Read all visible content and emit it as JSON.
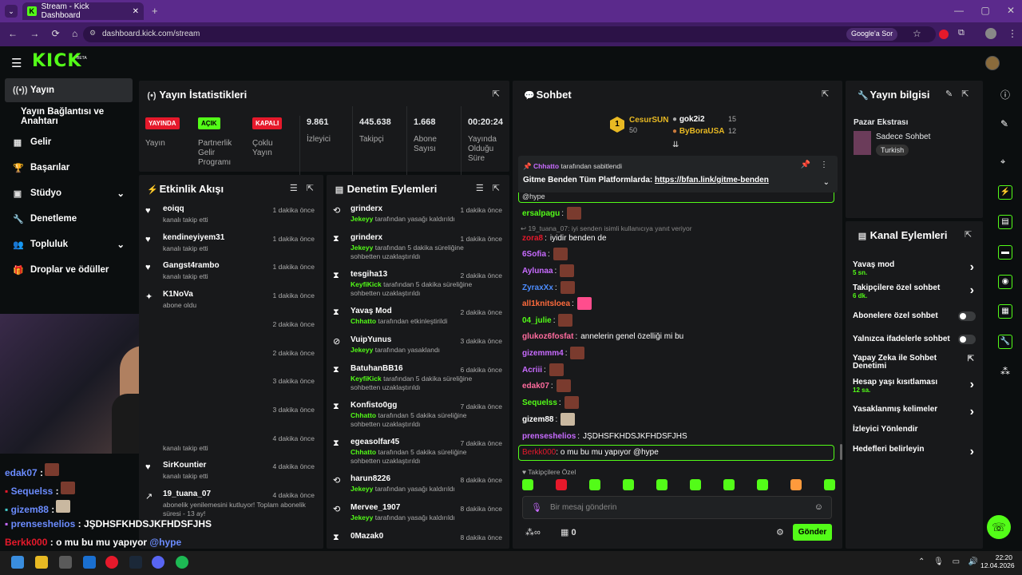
{
  "browser": {
    "tab_title": "Stream - Kick Dashboard",
    "url": "dashboard.kick.com/stream",
    "google_btn": "Google'a Sor"
  },
  "logo": "KICK",
  "logo_beta": "BETA",
  "sidebar": [
    {
      "label": "Yayın",
      "icon": "broadcast-icon"
    },
    {
      "label": "Yayın Bağlantısı ve Anahtarı"
    },
    {
      "label": "Gelir",
      "icon": "chart-icon"
    },
    {
      "label": "Başarılar",
      "icon": "trophy-icon"
    },
    {
      "label": "Stüdyo",
      "icon": "studio-icon"
    },
    {
      "label": "Denetleme",
      "icon": "wrench-icon"
    },
    {
      "label": "Topluluk",
      "icon": "people-icon"
    },
    {
      "label": "Droplar ve ödüller",
      "icon": "gift-icon"
    }
  ],
  "stats": {
    "title": "Yayın İstatistikleri",
    "items": [
      {
        "badge": "YAYINDA",
        "badge_color": "#e6192b",
        "label": "Yayın"
      },
      {
        "badge": "AÇIK",
        "badge_color": "#53fc18",
        "label": "Partnerlik Gelir Programı"
      },
      {
        "badge": "KAPALI",
        "badge_color": "#e6192b",
        "label": "Çoklu Yayın"
      },
      {
        "value": "9.861",
        "label": "İzleyici"
      },
      {
        "value": "445.638",
        "label": "Takipçi"
      },
      {
        "value": "1.668",
        "label": "Abone Sayısı"
      },
      {
        "value": "00:20:24",
        "label": "Yayında Olduğu Süre"
      }
    ]
  },
  "activity": {
    "title": "Etkinlik Akışı",
    "rows": [
      {
        "name": "eoiqq",
        "sub": "kanalı takip etti",
        "time": "1 dakika önce"
      },
      {
        "name": "kendineyiyem31",
        "sub": "kanalı takip etti",
        "time": "1 dakika önce"
      },
      {
        "name": "Gangst4rambo",
        "sub": "kanalı takip etti",
        "time": "1 dakika önce"
      },
      {
        "name": "K1NoVa",
        "sub": "abone oldu",
        "time": "1 dakika önce"
      },
      {
        "name": "",
        "sub": "",
        "time": "2 dakika önce"
      },
      {
        "name": "",
        "sub": "",
        "time": "2 dakika önce"
      },
      {
        "name": "",
        "sub": "",
        "time": "3 dakika önce"
      },
      {
        "name": "",
        "sub": "",
        "time": "3 dakika önce"
      },
      {
        "name": "",
        "sub": "kanalı takip etti",
        "time": "4 dakika önce"
      },
      {
        "name": "SirKountier",
        "sub": "kanalı takip etti",
        "time": "4 dakika önce"
      },
      {
        "name": "19_tuana_07",
        "sub": "abonelik yenilemesini kutluyor! Toplam abonelik süresi - 13 ay!",
        "time": "4 dakika önce"
      }
    ]
  },
  "mod": {
    "title": "Denetim Eylemleri",
    "rows": [
      {
        "name": "grinderx",
        "actor": "Jekeyy",
        "sub": "tarafından yasağı kaldırıldı",
        "time": "1 dakika önce"
      },
      {
        "name": "grinderx",
        "actor": "Jekeyy",
        "sub": "tarafından 5 dakika süreliğine sohbetten uzaklaştırıldı",
        "time": "1 dakika önce"
      },
      {
        "name": "tesgiha13",
        "actor": "KeyfiKick",
        "sub": "tarafından 5 dakika süreliğine sohbetten uzaklaştırıldı",
        "time": "2 dakika önce"
      },
      {
        "name": "Yavaş Mod",
        "actor": "Chhatto",
        "sub": "tarafından etkinleştirildi",
        "time": "2 dakika önce"
      },
      {
        "name": "VuipYunus",
        "actor": "Jekeyy",
        "sub": "tarafından yasaklandı",
        "time": "3 dakika önce"
      },
      {
        "name": "BatuhanBB16",
        "actor": "KeyfiKick",
        "sub": "tarafından 5 dakika süreliğine sohbetten uzaklaştırıldı",
        "time": "6 dakika önce"
      },
      {
        "name": "Konfisto0gg",
        "actor": "Chhatto",
        "sub": "tarafından 5 dakika süreliğine sohbetten uzaklaştırıldı",
        "time": "7 dakika önce"
      },
      {
        "name": "egeasolfar45",
        "actor": "Chhatto",
        "sub": "tarafından 5 dakika süreliğine sohbetten uzaklaştırıldı",
        "time": "7 dakika önce"
      },
      {
        "name": "harun8226",
        "actor": "Jekeyy",
        "sub": "tarafından yasağı kaldırıldı",
        "time": "8 dakika önce"
      },
      {
        "name": "Mervee_1907",
        "actor": "Jekeyy",
        "sub": "tarafından yasağı kaldırıldı",
        "time": "8 dakika önce"
      },
      {
        "name": "0Mazak0",
        "actor": "",
        "sub": "",
        "time": "8 dakika önce"
      }
    ]
  },
  "chat": {
    "title": "Sohbet",
    "top": [
      {
        "name": "CesurSUN",
        "count": "50"
      },
      {
        "name": "gok2i2",
        "count": "15"
      },
      {
        "name": "ByBoraUSA",
        "count": "12"
      }
    ],
    "pinned": {
      "by": "Chhatto",
      "by_text": "tarafından sabitlendi",
      "text": "Gitme Benden Tüm Platformlarda:",
      "link": "https://bfan.link/gitme-benden"
    },
    "reply_hint": "19_tuana_07: iyi senden isimli kullanıcıya yanıt veriyor",
    "hype_tag": "@hype",
    "lines": [
      {
        "user": "ersalpagu",
        "color": "#53fc18",
        "msg": ""
      },
      {
        "user": "zora8",
        "color": "#e6192b",
        "msg": "iyidir benden de"
      },
      {
        "user": "6Sofia",
        "color": "#c86bff",
        "msg": ""
      },
      {
        "user": "Aylunaa",
        "color": "#c86bff",
        "msg": ""
      },
      {
        "user": "ZyraxXx",
        "color": "#4c8dff",
        "msg": ""
      },
      {
        "user": "all1knitsloea",
        "color": "#ff6b3d",
        "msg": ""
      },
      {
        "user": "04_julie",
        "color": "#53fc18",
        "msg": ""
      },
      {
        "user": "glukoz6fosfat",
        "color": "#ff6b9e",
        "msg": "annelerin genel özelliği mi bu"
      },
      {
        "user": "gizemmm4",
        "color": "#c86bff",
        "msg": ""
      },
      {
        "user": "Acriii",
        "color": "#c86bff",
        "msg": ""
      },
      {
        "user": "edak07",
        "color": "#ff6b9e",
        "msg": ""
      },
      {
        "user": "Sequelss",
        "color": "#53fc18",
        "msg": ""
      },
      {
        "user": "gizem88",
        "color": "#ffffff",
        "msg": ""
      },
      {
        "user": "prenseshelios",
        "color": "#c86bff",
        "msg": "JŞDHSFKHDSJKFHDSFJHS"
      }
    ],
    "own": {
      "user": "Berkk000",
      "msg": "o mu bu mu yapıyor @hype"
    },
    "emote_label": "Takipçilere Özel",
    "placeholder": "Bir mesaj gönderin",
    "points": "0",
    "send": "Gönder"
  },
  "info": {
    "title": "Yayın bilgisi",
    "category": "Pazar Ekstrası",
    "mode": "Sadece Sohbet",
    "lang": "Turkish"
  },
  "actions": {
    "title": "Kanal Eylemleri",
    "rows": [
      {
        "label": "Yavaş mod",
        "sub": "5 sn.",
        "ctrl": "chevron"
      },
      {
        "label": "Takipçilere özel sohbet",
        "sub": "6 dk.",
        "ctrl": "chevron"
      },
      {
        "label": "Abonelere özel sohbet",
        "sub": "",
        "ctrl": "toggle"
      },
      {
        "label": "Yalnızca ifadelerle sohbet",
        "sub": "",
        "ctrl": "toggle"
      },
      {
        "label": "Yapay Zeka ile Sohbet Denetimi",
        "sub": "",
        "ctrl": "ext"
      },
      {
        "label": "Hesap yaşı kısıtlaması",
        "sub": "12 sa.",
        "ctrl": "chevron"
      },
      {
        "label": "Yasaklanmış kelimeler",
        "sub": "",
        "ctrl": "chevron"
      },
      {
        "label": "İzleyici Yönlendir",
        "sub": "",
        "ctrl": "none"
      },
      {
        "label": "Hedefleri belirleyin",
        "sub": "",
        "ctrl": "chevron"
      }
    ]
  },
  "overlay": {
    "lines": [
      {
        "user": "edak07",
        "color": "#6b8cff"
      },
      {
        "user": "Sequelss",
        "color": "#6b8cff"
      },
      {
        "user": "gizem88",
        "color": "#6b8cff"
      },
      {
        "user": "prenseshelios",
        "color": "#6b8cff",
        "msg": "JŞDHSFKHDSJKFHDSFJHS"
      },
      {
        "user": "Berkk000",
        "color": "#e6192b",
        "msg": "o mu bu mu yapıyor",
        "tag": "@hype"
      }
    ]
  },
  "taskbar": {
    "time": "22:20",
    "date": "12.04.2026"
  }
}
